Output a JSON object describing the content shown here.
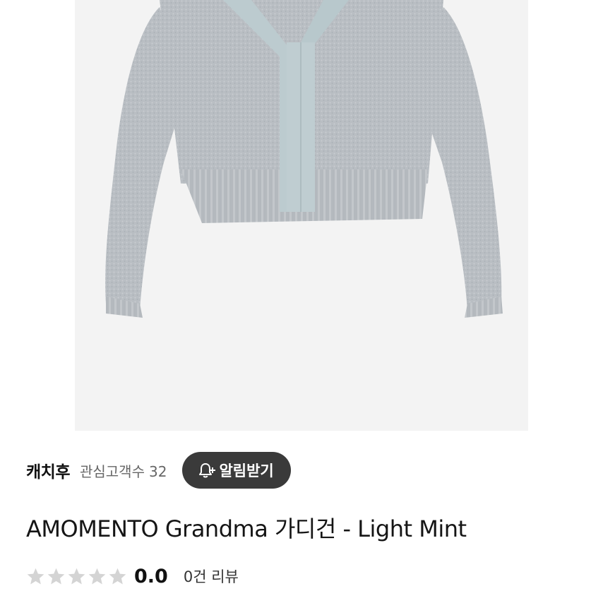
{
  "product": {
    "image_alt": "gray knit cardigan with light mint v-neck placket"
  },
  "seller": {
    "name": "캐치후",
    "followers_label": "관심고객수",
    "followers_count": "32",
    "notify_label": "알림받기",
    "notify_icon": "bell-plus-icon"
  },
  "listing": {
    "title": "AMOMENTO Grandma 가디건 - Light Mint"
  },
  "rating": {
    "stars_filled": 0,
    "stars_total": 5,
    "value": "0.0",
    "review_count": "0건",
    "review_label": "리뷰",
    "star_icon": "star-icon"
  },
  "colors": {
    "button_bg": "#3a3a3a",
    "star_empty": "#d4d4d4",
    "sweater_body": "#b7bcc1",
    "placket": "#bccbcf"
  }
}
